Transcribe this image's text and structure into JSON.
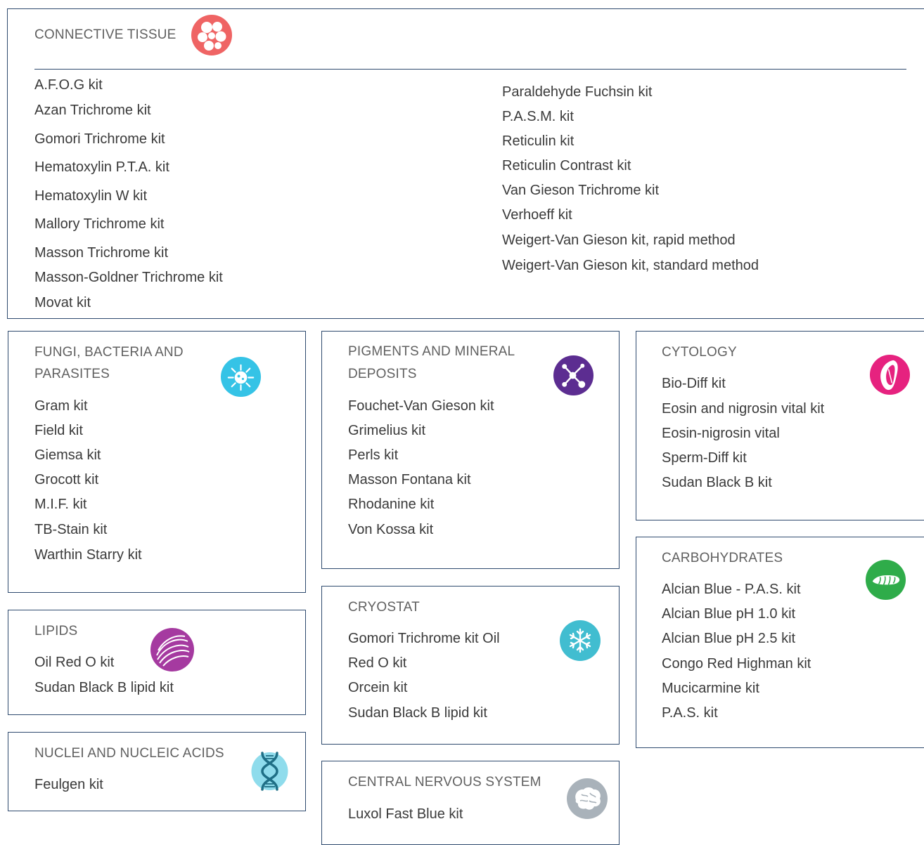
{
  "sections": {
    "connective_tissue": {
      "title": "CONNECTIVE TISSUE",
      "icon": "cells-icon",
      "color": "#ef6464",
      "col1": [
        "A.F.O.G kit",
        "Azan Trichrome kit",
        "Gomori Trichrome kit",
        "Hematoxylin P.T.A. kit",
        "Hematoxylin W kit",
        "Mallory Trichrome kit",
        "Masson Trichrome kit",
        "Masson-Goldner Trichrome kit",
        "Movat kit"
      ],
      "col2": [
        "Paraldehyde Fuchsin kit",
        "P.A.S.M. kit",
        "Reticulin kit",
        "Reticulin Contrast kit",
        "Van Gieson Trichrome kit",
        "Verhoeff kit",
        "Weigert-Van Gieson kit, rapid method",
        "Weigert-Van Gieson kit, standard method"
      ]
    },
    "fungi": {
      "title_line1": "FUNGI, BACTERIA AND",
      "title_line2": "PARASITES",
      "icon": "bacteria-icon",
      "color": "#35c3e6",
      "items": [
        "Gram kit",
        "Field kit",
        "Giemsa kit",
        "Grocott kit",
        "M.I.F. kit",
        "TB-Stain kit",
        "Warthin Starry kit"
      ]
    },
    "pigments": {
      "title_line1": "PIGMENTS AND MINERAL",
      "title_line2": "DEPOSITS",
      "icon": "molecule-icon",
      "color": "#5c2d91",
      "items": [
        "Fouchet-Van Gieson kit",
        "Grimelius kit",
        "Perls kit",
        "Masson Fontana kit",
        "Rhodanine kit",
        "Von Kossa kit"
      ]
    },
    "cytology": {
      "title": "CYTOLOGY",
      "icon": "cell-icon",
      "color": "#e6227f",
      "items": [
        "Bio-Diff kit",
        "Eosin and nigrosin vital kit",
        "Eosin-nigrosin vital",
        "Sperm-Diff kit",
        "Sudan Black B kit"
      ]
    },
    "lipids": {
      "title": "LIPIDS",
      "icon": "lipid-icon",
      "color": "#a53aa0",
      "items": [
        "Oil Red O kit",
        "Sudan Black B lipid kit"
      ]
    },
    "cryostat": {
      "title": "CRYOSTAT",
      "icon": "snowflake-icon",
      "color": "#41bdd0",
      "items": [
        "Gomori Trichrome kit Oil",
        "Red O kit",
        "Orcein kit",
        "Sudan Black B lipid kit"
      ]
    },
    "carbohydrates": {
      "title": "CARBOHYDRATES",
      "icon": "wheat-icon",
      "color": "#2fac4a",
      "items": [
        "Alcian Blue - P.A.S. kit",
        "Alcian Blue pH 1.0 kit",
        "Alcian Blue pH 2.5 kit",
        "Congo Red Highman kit",
        "Mucicarmine kit",
        "P.A.S. kit"
      ]
    },
    "nuclei": {
      "title": "NUCLEI AND NUCLEIC ACIDS",
      "icon": "dna-icon",
      "color": "#3cb6d3",
      "items": [
        "Feulgen kit"
      ]
    },
    "cns": {
      "title": "CENTRAL NERVOUS SYSTEM",
      "icon": "brain-icon",
      "color": "#a9b2ba",
      "items": [
        "Luxol Fast Blue kit"
      ]
    }
  }
}
